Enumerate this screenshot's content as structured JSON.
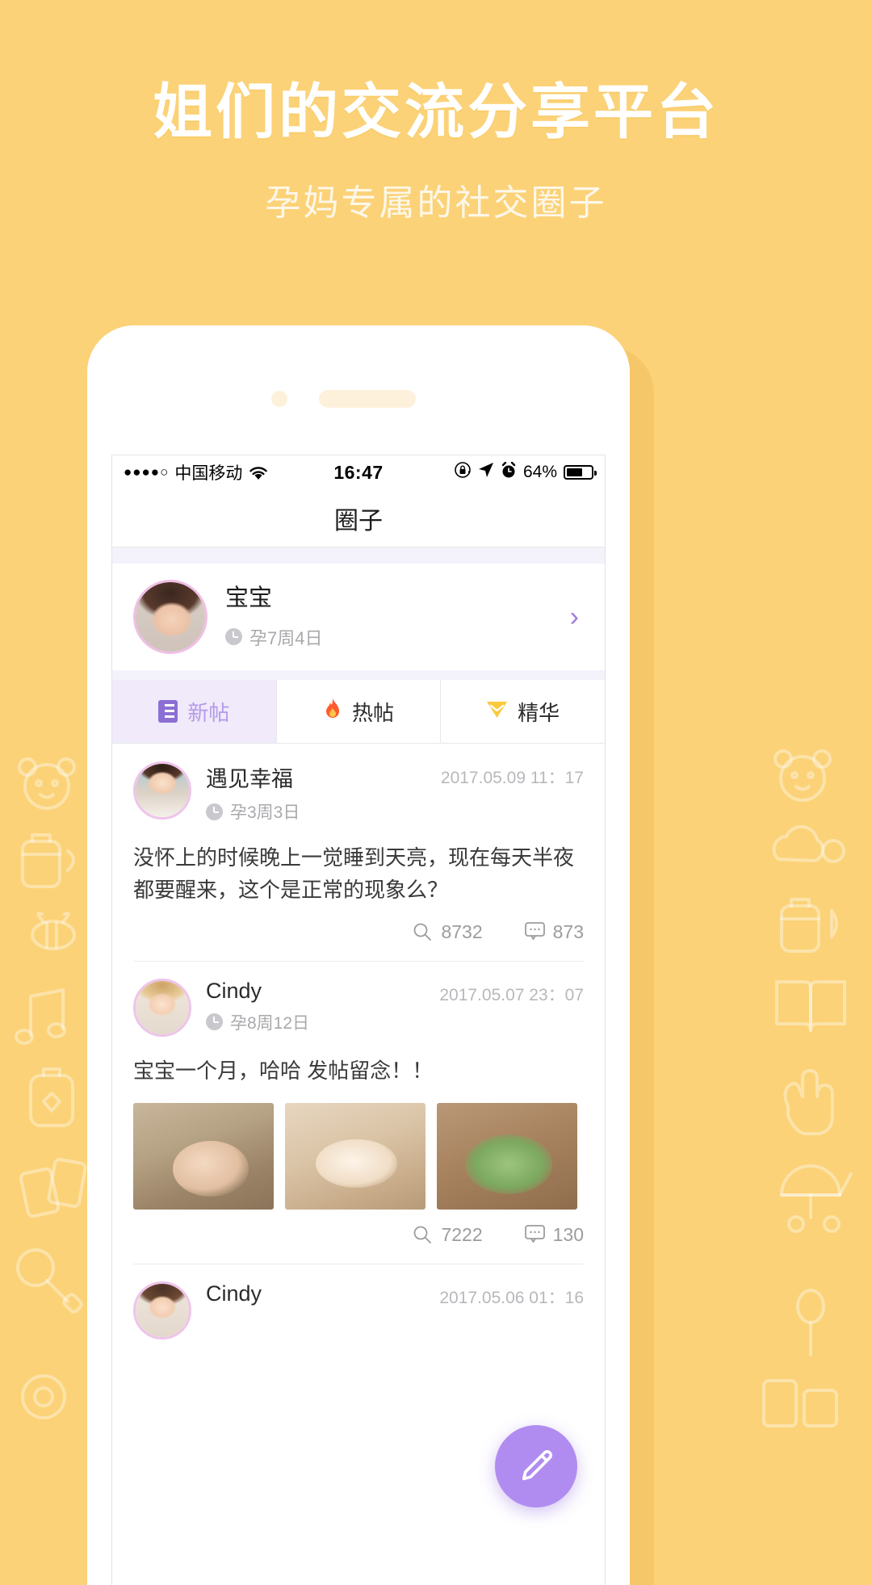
{
  "hero": {
    "title": "姐们的交流分享平台",
    "subtitle": "孕妈专属的社交圈子"
  },
  "colors": {
    "background": "#fbd277",
    "accent_purple": "#b18cf0",
    "tab_active_bg": "#f0eafb",
    "tab_active_text": "#b49ae8",
    "avatar_ring": "#eec4ea"
  },
  "statusbar": {
    "signal_dots": "●●●●○",
    "carrier": "中国移动",
    "wifi_icon": "wifi-icon",
    "time": "16:47",
    "rotation_lock_icon": "rotation-lock-icon",
    "location_icon": "location-arrow-icon",
    "alarm_icon": "alarm-clock-icon",
    "battery_percent": "64%",
    "battery_level": 64
  },
  "navbar": {
    "title": "圈子"
  },
  "profile": {
    "avatar": "user-avatar",
    "name": "宝宝",
    "clock_icon": "clock-icon",
    "pregnancy": "孕7周4日",
    "chevron": "›"
  },
  "tabs": [
    {
      "id": "new",
      "icon": "new-post-icon",
      "label": "新帖",
      "active": true
    },
    {
      "id": "hot",
      "icon": "fire-icon",
      "glyph": "🔥",
      "label": "热帖",
      "active": false
    },
    {
      "id": "featured",
      "icon": "gem-icon",
      "glyph": "♦",
      "label": "精华",
      "active": false
    }
  ],
  "posts": [
    {
      "avatar": "post-avatar-1",
      "name": "遇见幸福",
      "clock_icon": "clock-icon",
      "pregnancy": "孕3周3日",
      "time": "2017.05.09 11：17",
      "body": "没怀上的时候晚上一觉睡到天亮，现在每天半夜都要醒来，这个是正常的现象么？",
      "images": [],
      "views": "8732",
      "comments": "873"
    },
    {
      "avatar": "post-avatar-2",
      "name": "Cindy",
      "clock_icon": "clock-icon",
      "pregnancy": "孕8周12日",
      "time": "2017.05.07 23：07",
      "body": "宝宝一个月，哈哈 发帖留念！！",
      "images": [
        "baby-photo-1",
        "baby-photo-2",
        "baby-photo-3"
      ],
      "views": "7222",
      "comments": "130"
    },
    {
      "avatar": "post-avatar-3",
      "name": "Cindy",
      "clock_icon": "clock-icon",
      "pregnancy": "",
      "time": "2017.05.06 01：16",
      "body": "",
      "images": [],
      "views": "",
      "comments": ""
    }
  ],
  "fab": {
    "icon": "compose-pencil-icon"
  },
  "decorations": [
    "bear-face",
    "bottle",
    "bee",
    "music-note",
    "lotion",
    "book",
    "rattle",
    "stroller",
    "cloud",
    "teether",
    "blocks",
    "spoon"
  ]
}
